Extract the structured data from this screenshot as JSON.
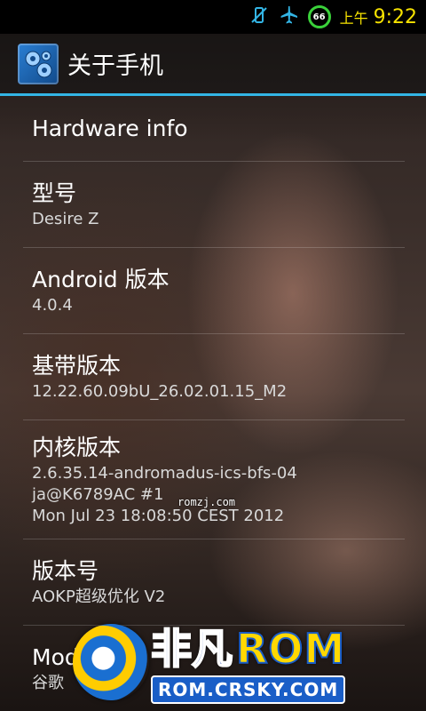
{
  "status_bar": {
    "icons": [
      "vibrate-off-icon",
      "airplane-mode-icon"
    ],
    "battery_level": "66",
    "ampm": "上午",
    "time": "9:22",
    "accent_color": "#33b5e5",
    "time_color": "#f6e200",
    "battery_color": "#3ad13a"
  },
  "action_bar": {
    "title": "关于手机",
    "icon": "settings-gears-icon"
  },
  "settings": {
    "section_header": "Hardware info",
    "items": [
      {
        "title": "型号",
        "summary": "Desire Z"
      },
      {
        "title": "Android 版本",
        "summary": "4.0.4"
      },
      {
        "title": "基带版本",
        "summary": "12.22.60.09bU_26.02.01.15_M2"
      },
      {
        "title": "内核版本",
        "summary": "2.6.35.14-andromadus-ics-bfs-04\nja@K6789AC #1\nMon Jul 23 18:08:50 CEST 2012"
      },
      {
        "title": "版本号",
        "summary": "AOKP超级优化 V2"
      },
      {
        "title": "Mod",
        "summary": "谷歌"
      }
    ]
  },
  "watermarks": {
    "small_text": "romzj.com",
    "logo_chars": "非凡",
    "logo_rom": "ROM",
    "logo_url": "ROM.CRSKY.COM"
  }
}
